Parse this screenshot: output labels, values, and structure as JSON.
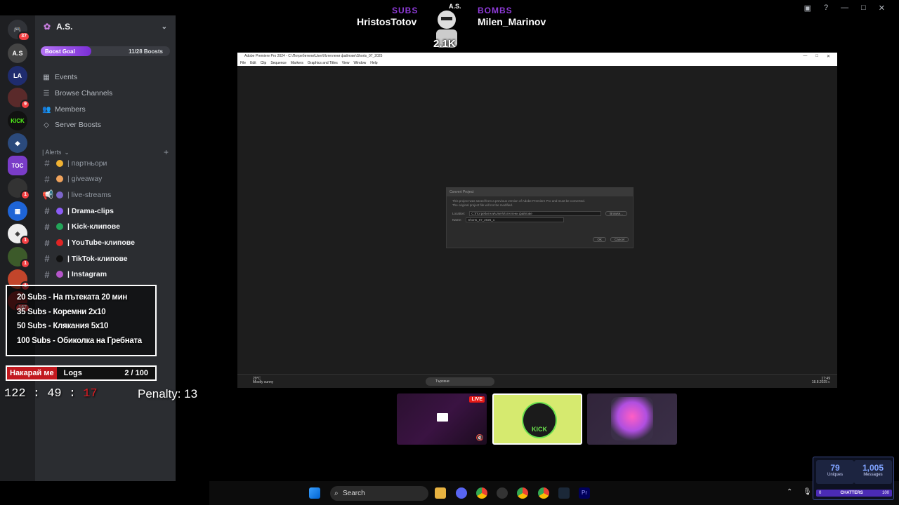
{
  "discord": {
    "server_name": "A.S.",
    "boost": {
      "label": "Boost Goal",
      "count": "11/28 Boosts",
      "progress": 0.39
    },
    "nav": [
      {
        "icon": "calendar-icon",
        "label": "Events"
      },
      {
        "icon": "channels-icon",
        "label": "Browse Channels"
      },
      {
        "icon": "members-icon",
        "label": "Members"
      },
      {
        "icon": "boost-icon",
        "label": "Server Boosts"
      }
    ],
    "category": "| Alerts",
    "channels": [
      {
        "prefix": "#",
        "label": "| партньори",
        "color": "#f0b232"
      },
      {
        "prefix": "#",
        "label": "| giveaway",
        "color": "#f0a35c"
      },
      {
        "prefix": "📢",
        "label": "| live-streams",
        "color": "#7b65c9"
      },
      {
        "prefix": "#",
        "label": "| Drama-clips",
        "color": "#8b5cf6"
      },
      {
        "prefix": "#",
        "label": "| Kick-клипове",
        "color": "#23a559"
      },
      {
        "prefix": "#",
        "label": "| YouTube-клипове",
        "color": "#e02424"
      },
      {
        "prefix": "#",
        "label": "| TikTok-клипове",
        "color": "#111111"
      },
      {
        "prefix": "#",
        "label": "| Instagram",
        "color": "#b455c9"
      }
    ],
    "server_badges": [
      "37",
      "9",
      "1",
      "1",
      "1",
      "1",
      "167"
    ]
  },
  "overlay": {
    "goals": [
      "20 Subs - На пътеката 20 мин",
      "35 Subs - Коремни 2x10",
      "50 Subs - Клякания 5x10",
      "100 Subs - Обиколка на Гребната"
    ],
    "bar_prefix": "Накарай ме",
    "bar_label": "Logs",
    "bar_count": "2 / 100",
    "timer_main": "122 : 49 : ",
    "timer_red": "17",
    "penalty": "Penalty: 13",
    "subs_label": "SUBS",
    "subs_name": "HristosTotov",
    "bombs_label": "BOMBS",
    "bombs_name": "Milen_Marinov",
    "mascot_tag": "A.S.",
    "mascot_count": "2.1K"
  },
  "premiere": {
    "title": "Adobe Premiere Pro 2024 - C:\\Потребители\\User\\Изтеглени файлове\\Shorts_07_2025",
    "menu": [
      "File",
      "Edit",
      "Clip",
      "Sequence",
      "Markers",
      "Graphics and Titles",
      "View",
      "Window",
      "Help"
    ],
    "dialog": {
      "title": "Convert Project",
      "msg1": "This project was saved from a previous version of Adobe Premiere Pro and must be converted.",
      "msg2": "The original project file will not be modified.",
      "location_label": "Location:",
      "location_value": "C:\\Потребители\\User\\Изтеглени файлове",
      "browse": "Browse...",
      "name_label": "Name:",
      "name_value": "Shorts_07_2025_1",
      "ok": "OK",
      "cancel": "Cancel"
    },
    "inner_taskbar": {
      "weather_temp": "29°C",
      "weather_desc": "Mostly sunny",
      "search": "Търсене",
      "time": "17:49",
      "date": "18.8.2025 г."
    }
  },
  "thumbs": {
    "live": "LIVE",
    "kick_logo": "KICK"
  },
  "taskbar": {
    "search": "Search"
  },
  "stats": {
    "uniques_value": "79",
    "uniques_label": "Uniques",
    "messages_value": "1,005",
    "messages_label": "Messages",
    "chatters_min": "0",
    "chatters_label": "CHATTERS",
    "chatters_max": "100"
  }
}
